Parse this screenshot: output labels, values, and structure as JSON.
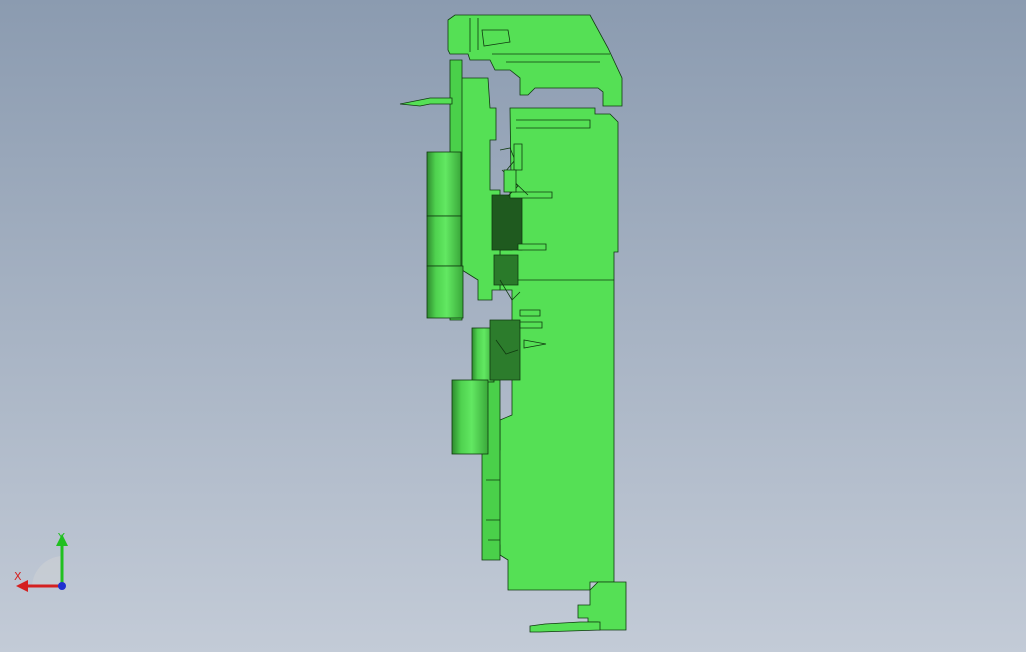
{
  "viewport": {
    "background_top": "#8b9bb0",
    "background_bottom": "#c3cbd7"
  },
  "model": {
    "fill_color": "#55e055",
    "shade_color": "#3dbb3d",
    "dark_color": "#1f5a1f",
    "edge_color": "#103a10"
  },
  "triad": {
    "x_label": "X",
    "y_label": "Y",
    "x_color": "#d42020",
    "y_color": "#20c020",
    "z_color": "#2030d0"
  }
}
